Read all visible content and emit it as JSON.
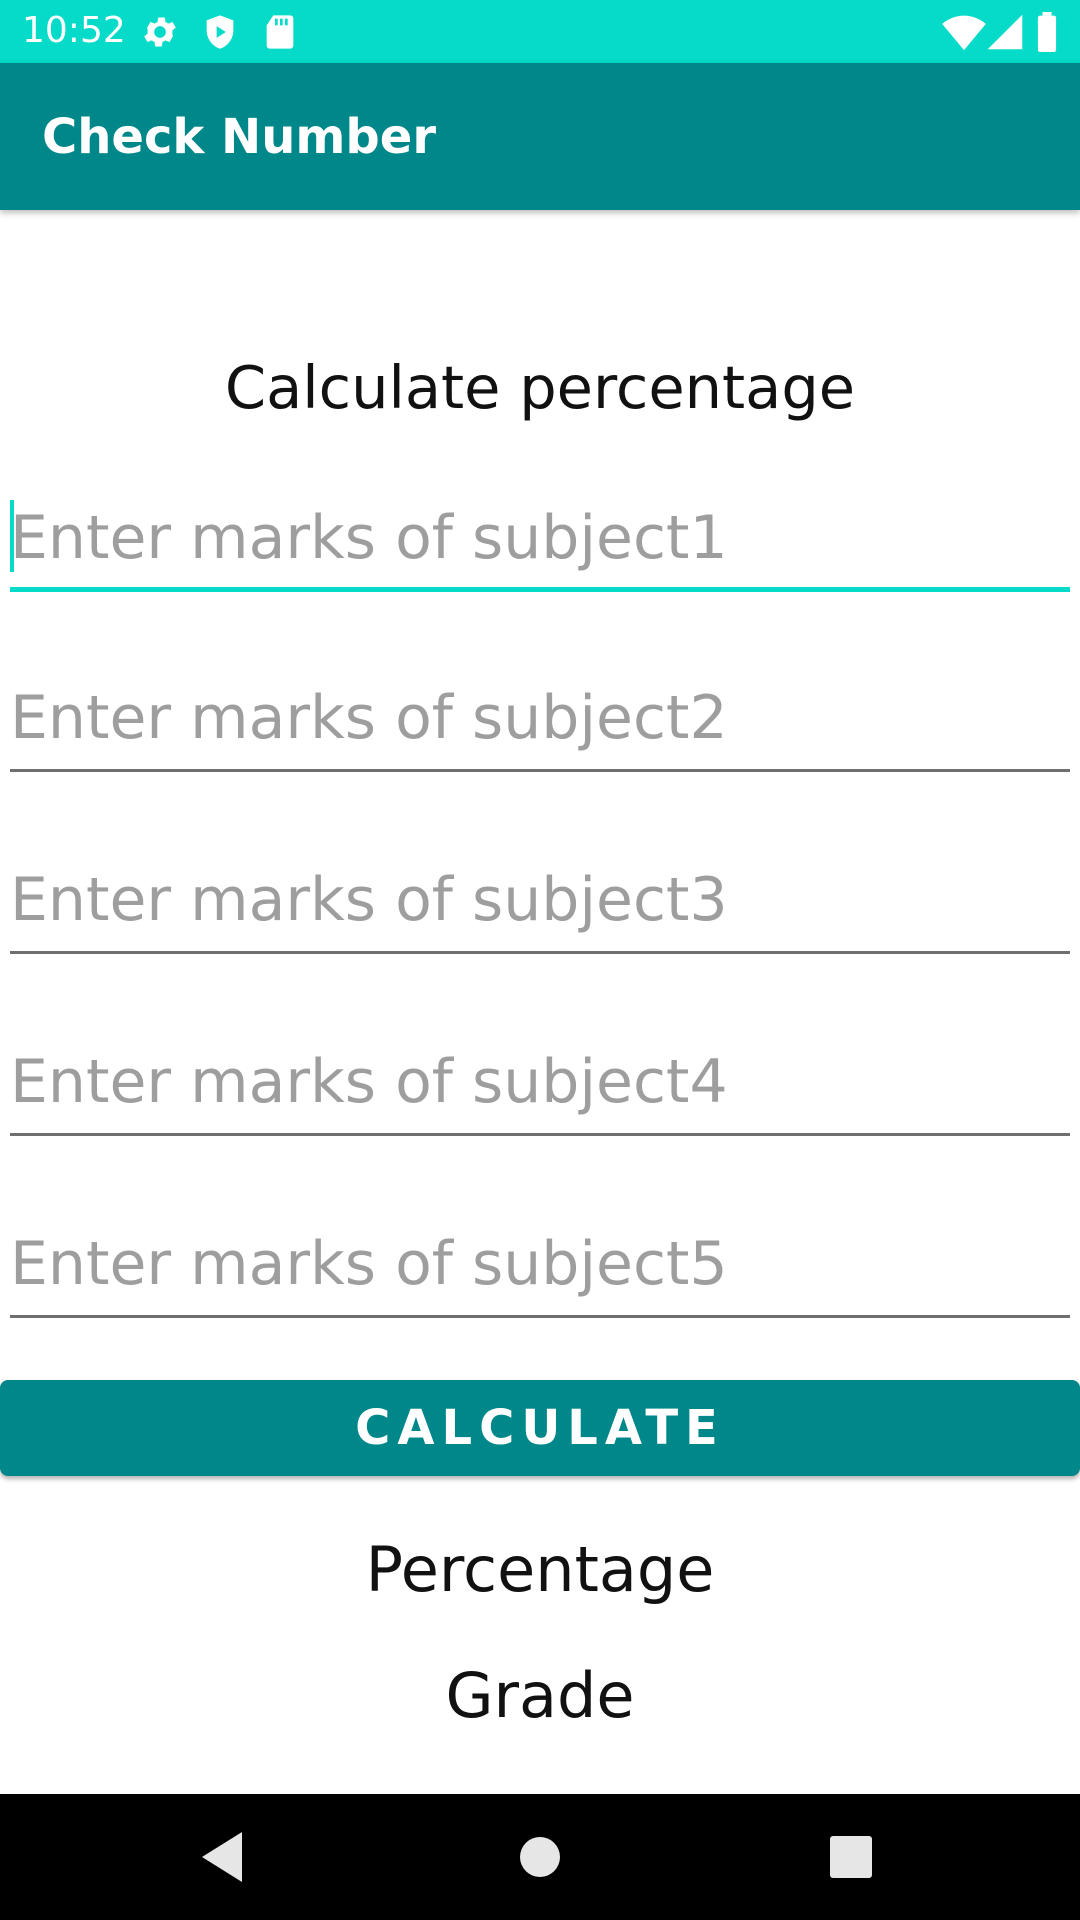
{
  "status_bar": {
    "time": "10:52",
    "left_icons": [
      "gear-icon",
      "shield-play-icon",
      "sd-card-icon"
    ],
    "right_icons": [
      "wifi-icon",
      "cell-signal-icon",
      "battery-icon"
    ]
  },
  "app_bar": {
    "title": "Check Number"
  },
  "main": {
    "heading": "Calculate percentage",
    "fields": [
      {
        "placeholder": "Enter marks of subject1",
        "value": ""
      },
      {
        "placeholder": "Enter marks of subject2",
        "value": ""
      },
      {
        "placeholder": "Enter marks of subject3",
        "value": ""
      },
      {
        "placeholder": "Enter marks of subject4",
        "value": ""
      },
      {
        "placeholder": "Enter marks of subject5",
        "value": ""
      }
    ],
    "button_label": "CALCULATE",
    "percentage_label": "Percentage",
    "grade_label": "Grade"
  },
  "nav_bar": {
    "buttons": [
      "back-icon",
      "home-icon",
      "recents-icon"
    ]
  },
  "colors": {
    "status_bar": "#05DBC8",
    "app_bar": "#00878A",
    "accent": "#05DBC8",
    "button": "#00878A"
  }
}
